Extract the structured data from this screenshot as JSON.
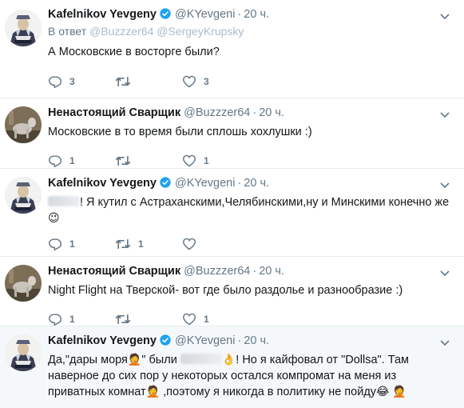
{
  "tweets": [
    {
      "name": "Kafelnikov Yevgeny",
      "handle": "@KYevgeni",
      "dot": "·",
      "time": "20 ч.",
      "reply_prefix": "В ответ",
      "reply_users": "@Buzzzer64 @SergeyKrupsky",
      "text": "А Московские в восторге были?",
      "replies": "3",
      "retweets": "",
      "likes": "3"
    },
    {
      "name": "Ненастоящий Сварщик",
      "handle": "@Buzzzer64",
      "dot": "·",
      "time": "20 ч.",
      "text": "Московские в то время были сплошь хохлушки :)",
      "replies": "1",
      "retweets": "",
      "likes": "1"
    },
    {
      "name": "Kafelnikov Yevgeny",
      "handle": "@KYevgeni",
      "dot": "·",
      "time": "20 ч.",
      "text": "! Я кутил с Астраханскими,Челябинскими,ну и Минскими конечно же",
      "emoji_after": "😉",
      "replies": "1",
      "retweets": "1",
      "likes": ""
    },
    {
      "name": "Ненастоящий Сварщик",
      "handle": "@Buzzzer64",
      "dot": "·",
      "time": "20 ч.",
      "text": "Night Flight на Тверской- вот где было раздолье и разнообразие :)",
      "replies": "1",
      "retweets": "",
      "likes": "1"
    },
    {
      "name": "Kafelnikov Yevgeny",
      "handle": "@KYevgeni",
      "dot": "·",
      "time": "20 ч.",
      "text_a": "Да,\"дары моря",
      "emoji_a": "🤦",
      "text_b": "\" были",
      "emoji_b": "👌",
      "text_c": "! Но я кайфовал от \"Dollsa\". Там наверное до сих пор у некоторых остался компромат на меня из приватных комнат",
      "emoji_c": "🤦",
      "text_d": ",поэтому я никогда в политику не пойду",
      "emoji_d": "😂 🤦"
    }
  ],
  "colors": {
    "text": "#14171a",
    "secondary": "#657786",
    "verified": "#1da1f2",
    "divider": "#e6ecf0",
    "highlight_bg": "#f5f8fa"
  }
}
